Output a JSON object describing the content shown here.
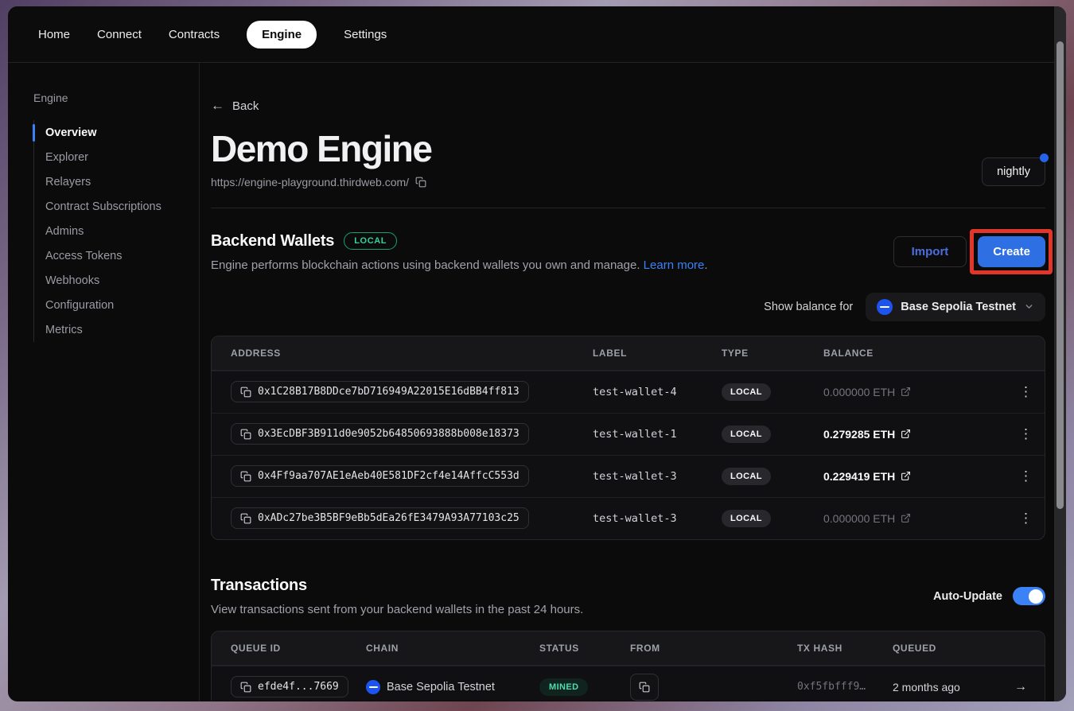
{
  "nav": {
    "items": [
      {
        "label": "Home",
        "active": false
      },
      {
        "label": "Connect",
        "active": false
      },
      {
        "label": "Contracts",
        "active": false
      },
      {
        "label": "Engine",
        "active": true
      },
      {
        "label": "Settings",
        "active": false
      }
    ]
  },
  "sidebar": {
    "title": "Engine",
    "items": [
      {
        "label": "Overview",
        "active": true
      },
      {
        "label": "Explorer",
        "active": false
      },
      {
        "label": "Relayers",
        "active": false
      },
      {
        "label": "Contract Subscriptions",
        "active": false
      },
      {
        "label": "Admins",
        "active": false
      },
      {
        "label": "Access Tokens",
        "active": false
      },
      {
        "label": "Webhooks",
        "active": false
      },
      {
        "label": "Configuration",
        "active": false
      },
      {
        "label": "Metrics",
        "active": false
      }
    ]
  },
  "header": {
    "back_label": "Back",
    "title": "Demo Engine",
    "url": "https://engine-playground.thirdweb.com/",
    "version_badge": "nightly"
  },
  "backend_wallets": {
    "title": "Backend Wallets",
    "badge": "LOCAL",
    "description": "Engine performs blockchain actions using backend wallets you own and manage.",
    "learn_more": "Learn more",
    "learn_more_suffix": ".",
    "import_label": "Import",
    "create_label": "Create",
    "show_balance_label": "Show balance for",
    "chain_selector": "Base Sepolia Testnet",
    "table": {
      "headers": [
        "ADDRESS",
        "LABEL",
        "TYPE",
        "BALANCE"
      ],
      "rows": [
        {
          "address": "0x1C28B17B8DDce7bD716949A22015E16dBB4ff813",
          "label": "test-wallet-4",
          "type": "LOCAL",
          "balance": "0.000000 ETH"
        },
        {
          "address": "0x3EcDBF3B911d0e9052b64850693888b008e18373",
          "label": "test-wallet-1",
          "type": "LOCAL",
          "balance": "0.279285 ETH"
        },
        {
          "address": "0x4Ff9aa707AE1eAeb40E581DF2cf4e14AffcC553d",
          "label": "test-wallet-3",
          "type": "LOCAL",
          "balance": "0.229419 ETH"
        },
        {
          "address": "0xADc27be3B5BF9eBb5dEa26fE3479A93A77103c25",
          "label": "test-wallet-3",
          "type": "LOCAL",
          "balance": "0.000000 ETH"
        }
      ]
    }
  },
  "transactions": {
    "title": "Transactions",
    "description": "View transactions sent from your backend wallets in the past 24 hours.",
    "auto_update_label": "Auto-Update",
    "table": {
      "headers": [
        "QUEUE ID",
        "CHAIN",
        "STATUS",
        "FROM",
        "TX HASH",
        "QUEUED"
      ],
      "rows": [
        {
          "queue_id": "efde4f...7669",
          "chain": "Base Sepolia Testnet",
          "status": "MINED",
          "tx_hash": "0xf5fbfff9…",
          "queued": "2 months ago"
        }
      ]
    }
  },
  "icons": {
    "arrow_left": "←",
    "arrow_right": "→",
    "kebab": "⋮"
  },
  "colors": {
    "accent_blue": "#3b82f6",
    "create_blue": "#2f6fe4",
    "success_green": "#34d399",
    "highlight_red": "#e3362b",
    "base_chain_blue": "#1d54f0"
  }
}
